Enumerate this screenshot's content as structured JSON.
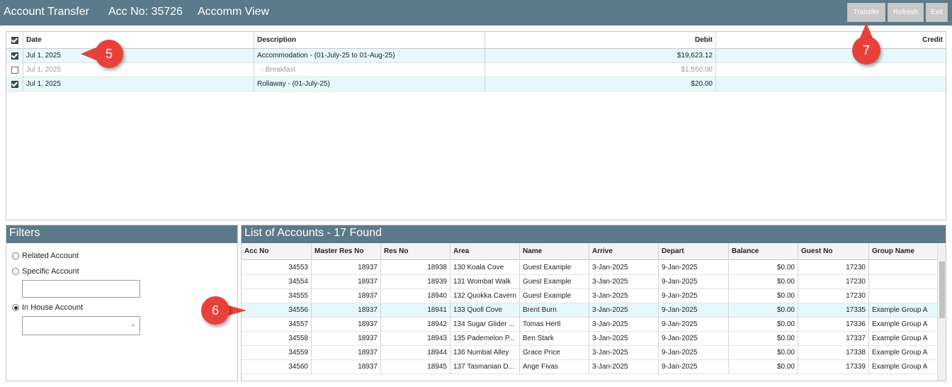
{
  "header": {
    "title": "Account Transfer",
    "acc_no": "Acc No: 35726",
    "view": "Accomm View",
    "buttons": {
      "transfer": "Transfer",
      "refresh": "Refresh",
      "exit": "Exit"
    }
  },
  "transactions": {
    "columns": {
      "date": "Date",
      "description": "Description",
      "debit": "Debit",
      "credit": "Credit"
    },
    "rows": [
      {
        "checked": true,
        "date": "Jul 1, 2025",
        "description": "Accommodation - (01-July-25 to 01-Aug-25)",
        "debit": "$19,623.12",
        "credit": ""
      },
      {
        "checked": false,
        "date": "Jul 1, 2025",
        "description": "  - Breakfast",
        "debit": "$1,550.00",
        "credit": ""
      },
      {
        "checked": true,
        "date": "Jul 1, 2025",
        "description": "Rollaway - (01-July-25)",
        "debit": "$20.00",
        "credit": ""
      }
    ]
  },
  "filters": {
    "title": "Filters",
    "related_account": "Related Account",
    "specific_account": "Specific Account",
    "specific_account_value": "",
    "in_house_account": "In House Account",
    "in_house_value": "",
    "selected": "in_house"
  },
  "accounts": {
    "title": "List of Accounts - 17 Found",
    "columns": [
      "Acc No",
      "Master Res No",
      "Res No",
      "Area",
      "Name",
      "Arrive",
      "Depart",
      "Balance",
      "Guest No",
      "Group Name"
    ],
    "rows": [
      [
        "34553",
        "18937",
        "18938",
        "130 Koala Cove",
        "Guest Example",
        "3-Jan-2025",
        "9-Jan-2025",
        "$0.00",
        "17230",
        ""
      ],
      [
        "34554",
        "18937",
        "18939",
        "131 Wombat Walk",
        "Guest Example",
        "3-Jan-2025",
        "9-Jan-2025",
        "$0.00",
        "17230",
        ""
      ],
      [
        "34555",
        "18937",
        "18940",
        "132 Quokka Cavern",
        "Guest Example",
        "3-Jan-2025",
        "9-Jan-2025",
        "$0.00",
        "17230",
        ""
      ],
      [
        "34556",
        "18937",
        "18941",
        "133 Quoll Cove",
        "Brent Burn",
        "3-Jan-2025",
        "9-Jan-2025",
        "$0.00",
        "17335",
        "Example Group A"
      ],
      [
        "34557",
        "18937",
        "18942",
        "134 Sugar Glider ...",
        "Tomas Hertl",
        "3-Jan-2025",
        "9-Jan-2025",
        "$0.00",
        "17336",
        "Example Group A"
      ],
      [
        "34558",
        "18937",
        "18943",
        "135 Pademelon P...",
        "Ben Stark",
        "3-Jan-2025",
        "9-Jan-2025",
        "$0.00",
        "17337",
        "Example Group A"
      ],
      [
        "34559",
        "18937",
        "18944",
        "136 Numbat Alley",
        "Grace Price",
        "3-Jan-2025",
        "9-Jan-2025",
        "$0.00",
        "17338",
        "Example Group A"
      ],
      [
        "34560",
        "18937",
        "18945",
        "137 Tasmanian D...",
        "Ange Fivas",
        "3-Jan-2025",
        "9-Jan-2025",
        "$0.00",
        "17339",
        "Example Group A"
      ]
    ],
    "selected_row": 3
  },
  "callouts": {
    "five": "5",
    "six": "6",
    "seven": "7"
  },
  "colors": {
    "header_bg": "#5c7a8a",
    "selected_row": "#e6f8fc",
    "callout": "#e8413a"
  }
}
